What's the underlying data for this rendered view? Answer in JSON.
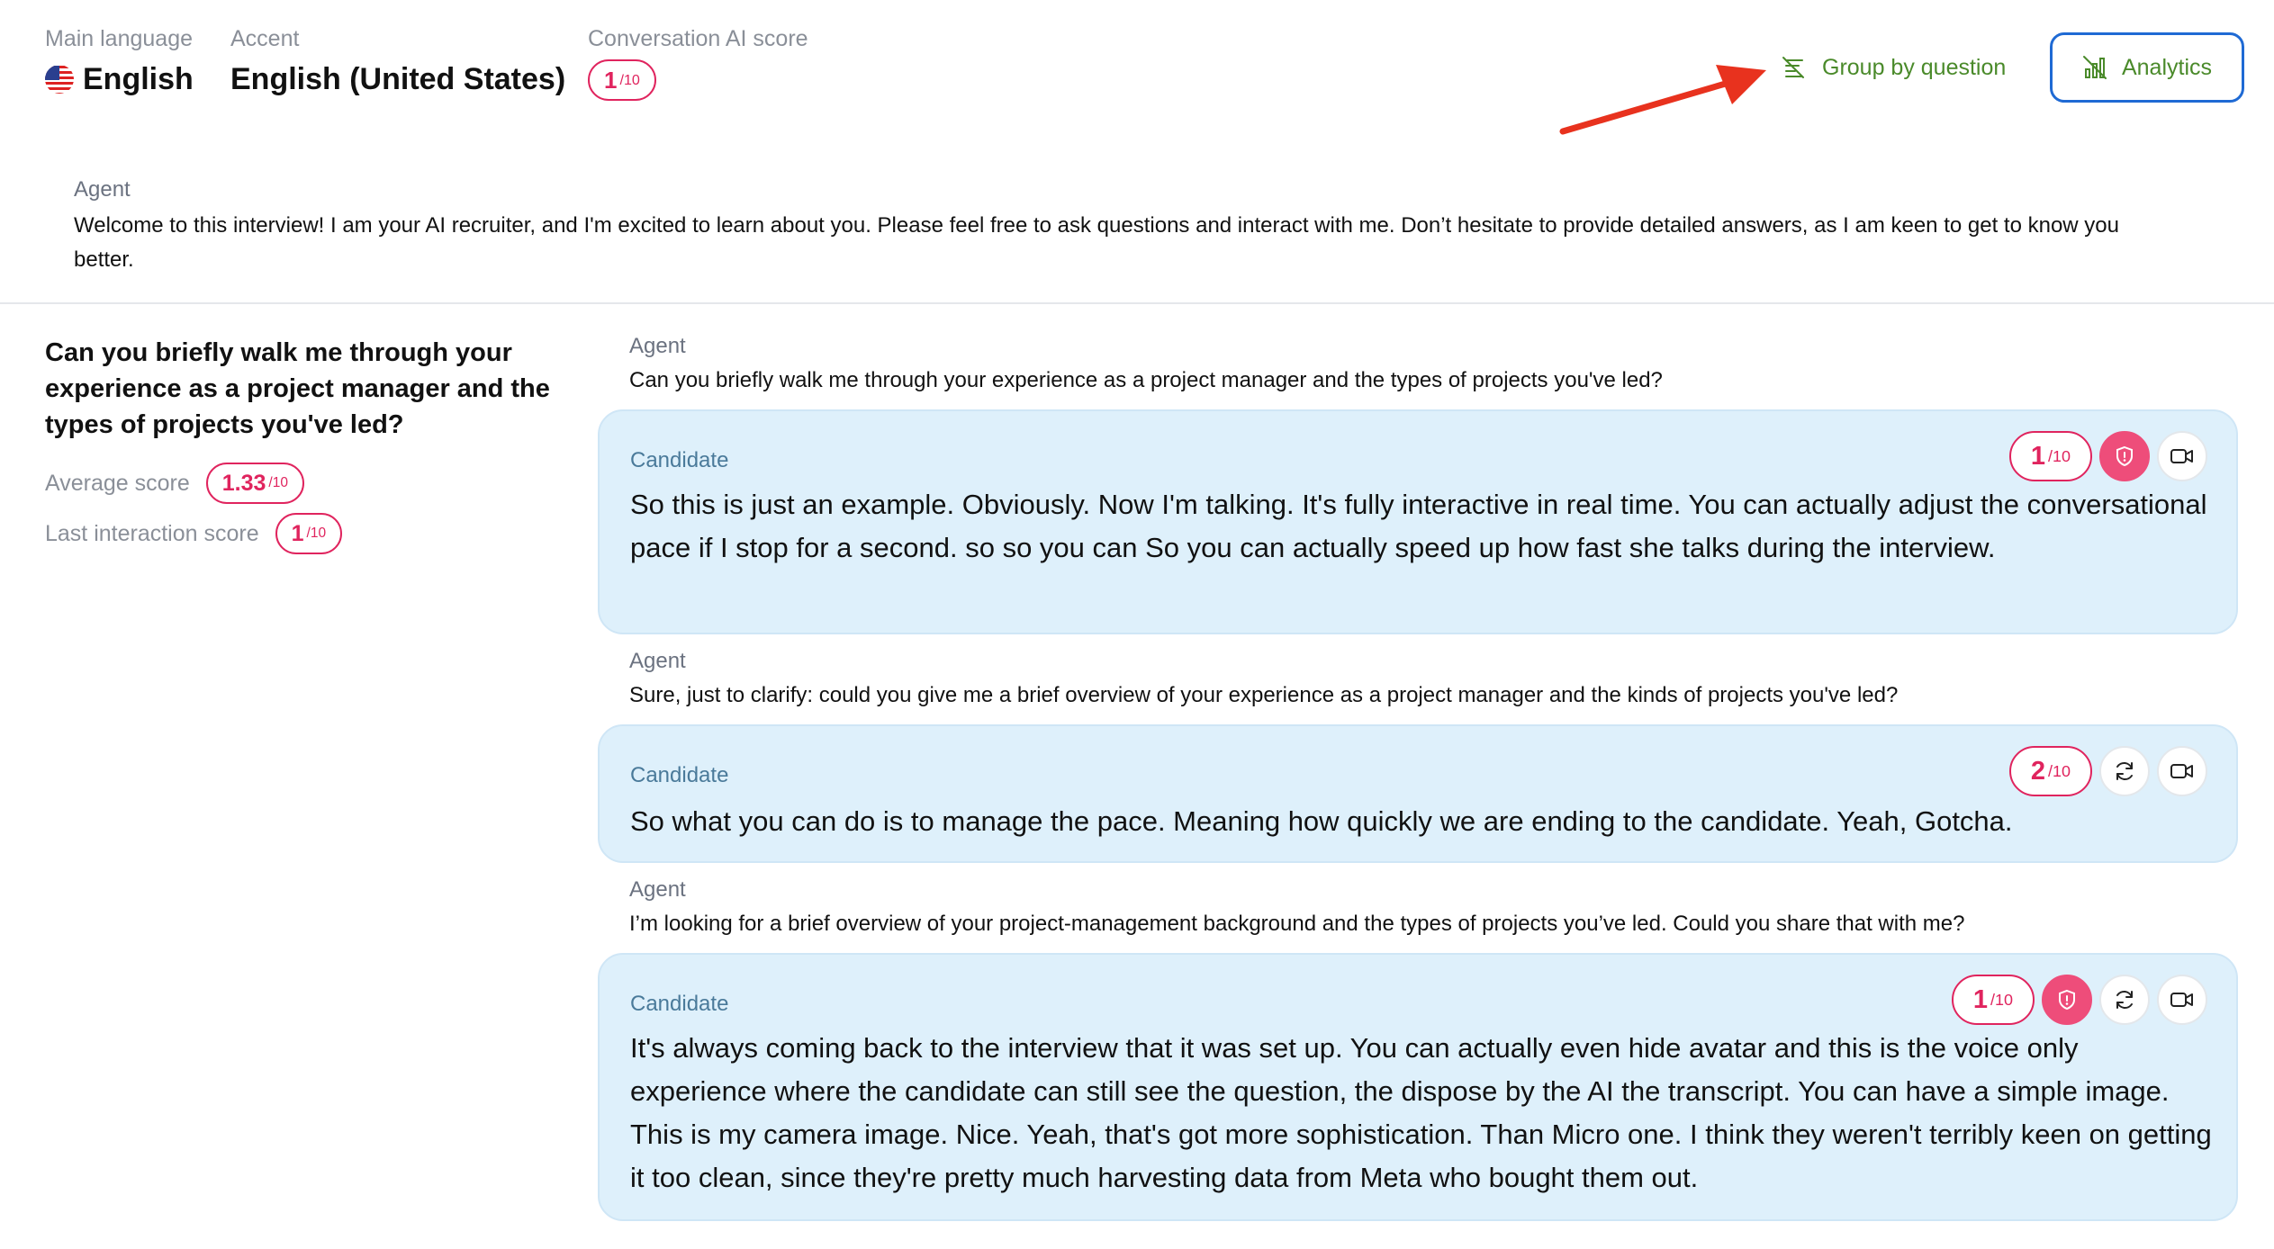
{
  "header": {
    "main_language_label": "Main language",
    "main_language_value": "English",
    "accent_label": "Accent",
    "accent_value": "English (United States)",
    "ai_score_label": "Conversation AI score",
    "ai_score": "1",
    "ai_score_den": "/10",
    "group_by_label": "Group by question",
    "analytics_label": "Analytics"
  },
  "intro": {
    "role": "Agent",
    "text": "Welcome to this interview! I am your AI recruiter, and I'm excited to learn about you. Please feel free to ask questions and interact with me. Don’t hesitate to provide detailed answers, as I am keen to get to know you better."
  },
  "question": {
    "title": "Can you briefly walk me through your experience as a project manager and the types of projects you've led?",
    "average_label": "Average score",
    "average_value": "1.33",
    "last_label": "Last interaction score",
    "last_value": "1",
    "den": "/10"
  },
  "thread": [
    {
      "agent_role": "Agent",
      "agent_text": "Can you briefly walk me through your experience as a project manager and the types of projects you've led?",
      "cand_role": "Candidate",
      "cand_text": "So this is just an example. Obviously. Now I'm talking. It's fully interactive in real time. You can actually adjust the conversational pace if I stop for a second. so so you can So you can actually speed up how fast she talks during the interview.",
      "score": "1",
      "den": "/10"
    },
    {
      "agent_role": "Agent",
      "agent_text": "Sure, just to clarify: could you give me a brief overview of your experience as a project manager and the kinds of projects you've led?",
      "cand_role": "Candidate",
      "cand_text": "So what you can do is to manage the pace. Meaning how quickly we are ending to the candidate. Yeah, Gotcha.",
      "score": "2",
      "den": "/10"
    },
    {
      "agent_role": "Agent",
      "agent_text": "I’m looking for a brief overview of your project-management background and the types of projects you’ve led. Could you share that with me?",
      "cand_role": "Candidate",
      "cand_text": "It's always coming back to the interview that it was set up. You can actually even hide avatar and this is the voice only experience where the candidate can still see the question, the dispose by the AI the transcript. You can have a simple image. This is my camera image. Nice. Yeah, that's got more sophistication. Than Micro one. I think they weren't terribly keen on getting it too clean, since they're pretty much harvesting data from Meta who bought them out.",
      "score": "1",
      "den": "/10"
    }
  ],
  "colors": {
    "score_red": "#e0245e",
    "candidate_bg": "#def0fb",
    "analytics_border": "#1f6ad4",
    "button_text": "#4a8a2a",
    "arrow": "#e8321e"
  }
}
